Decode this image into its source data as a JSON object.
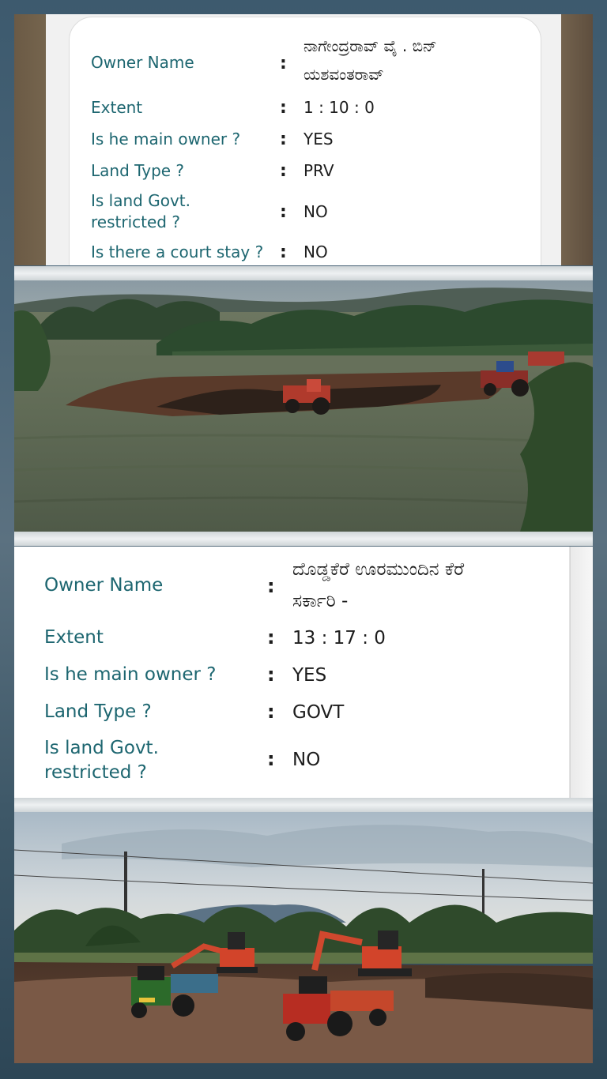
{
  "record_1": {
    "rows": [
      {
        "label": "Owner Name",
        "value": "ನಾಗೇಂದ್ರರಾವ್ ವೈ . ಬಿನ್ ಯಶವಂತರಾವ್",
        "value_lines": [
          "ನಾಗೇಂದ್ರರಾವ್ ವೈ . ಬಿನ್",
          "ಯಶವಂತರಾವ್"
        ]
      },
      {
        "label": "Extent",
        "value": "1 : 10 : 0"
      },
      {
        "label": "Is he main owner ?",
        "value": "YES"
      },
      {
        "label": "Land Type ?",
        "value": "PRV"
      },
      {
        "label": "Is land Govt. restricted ?",
        "label_lines": [
          "Is land Govt.",
          "restricted ?"
        ],
        "value": "NO"
      },
      {
        "label": "Is there a court stay ?",
        "value": "NO"
      }
    ]
  },
  "record_2": {
    "rows": [
      {
        "label": "Owner Name",
        "value": "ದೊಡ್ಡಕೆರೆ ಊರಮುಂದಿನ ಕೆರೆ ಸರ್ಕಾರಿ -",
        "value_lines": [
          "ದೊಡ್ಡಕೆರೆ ಊರಮುಂದಿನ ಕೆರೆ",
          "ಸರ್ಕಾರಿ -"
        ]
      },
      {
        "label": "Extent",
        "value": "13 : 17 : 0"
      },
      {
        "label": "Is he main owner ?",
        "value": "YES"
      },
      {
        "label": "Land Type ?",
        "value": "GOVT"
      },
      {
        "label": "Is land Govt. restricted ?",
        "label_lines": [
          "Is land Govt.",
          "restricted ?"
        ],
        "value": "NO"
      }
    ]
  },
  "colon": ":",
  "colors": {
    "label": "#1d6670",
    "value": "#1d1d1d",
    "frame": "#3d5a6e"
  },
  "photos": [
    {
      "subject": "farmland-with-tractors-and-excavated-soil"
    },
    {
      "subject": "lake-bed-excavation-with-excavators-and-tractors"
    }
  ]
}
